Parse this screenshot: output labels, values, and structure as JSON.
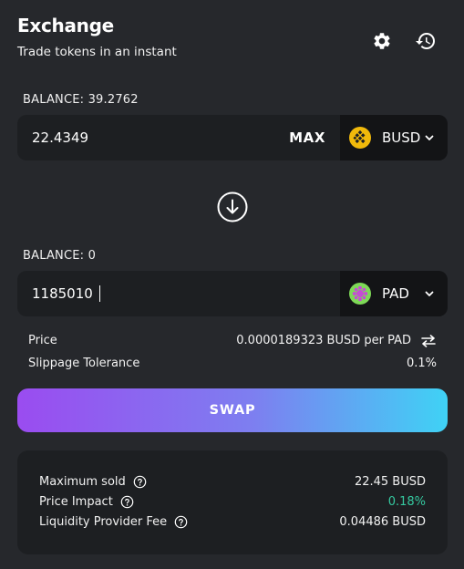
{
  "header": {
    "title": "Exchange",
    "subtitle": "Trade tokens in an instant",
    "settings_icon": "gear-icon",
    "history_icon": "history-icon"
  },
  "from": {
    "balance_label": "BALANCE: 39.2762",
    "amount": "22.4349",
    "max_label": "MAX",
    "token": "BUSD",
    "token_color": "#f0b90b"
  },
  "to": {
    "balance_label": "BALANCE: 0",
    "amount": "1185010",
    "token": "PAD",
    "token_color": "#7ed957"
  },
  "price": {
    "label": "Price",
    "value": "0.0000189323 BUSD per PAD"
  },
  "slippage": {
    "label": "Slippage Tolerance",
    "value": "0.1%"
  },
  "swap_label": "SWAP",
  "details": {
    "max_sold_label": "Maximum sold",
    "max_sold_value": "22.45 BUSD",
    "price_impact_label": "Price Impact",
    "price_impact_value": "0.18%",
    "lp_fee_label": "Liquidity Provider Fee",
    "lp_fee_value": "0.04486 BUSD"
  },
  "colors": {
    "background": "#26282c",
    "panel": "#1d1f22",
    "token_panel": "#131416",
    "accent_green": "#35c9a0",
    "gradient_start": "#9a4cf0",
    "gradient_end": "#3fd2f5"
  }
}
